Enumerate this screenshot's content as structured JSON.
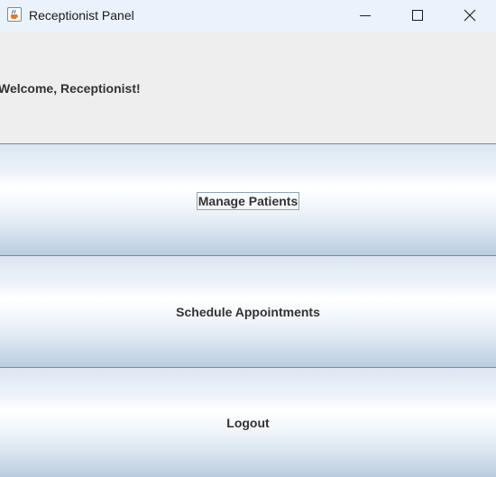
{
  "window": {
    "title": "Receptionist Panel",
    "icon": "java-cup-icon",
    "controls": {
      "minimize": "minimize-icon",
      "maximize": "maximize-icon",
      "close": "close-icon"
    }
  },
  "welcome": {
    "text": "Welcome, Receptionist!"
  },
  "buttons": {
    "manage_patients": "Manage Patients",
    "schedule_appointments": "Schedule Appointments",
    "logout": "Logout"
  },
  "colors": {
    "titlebar_bg": "#eaf2fb",
    "panel_bg": "#eeeeee",
    "button_gradient_top": "#dce6f1",
    "button_gradient_highlight": "#ffffff",
    "button_gradient_bottom": "#b9cde0",
    "text": "#333333"
  },
  "focused_button": "manage_patients"
}
